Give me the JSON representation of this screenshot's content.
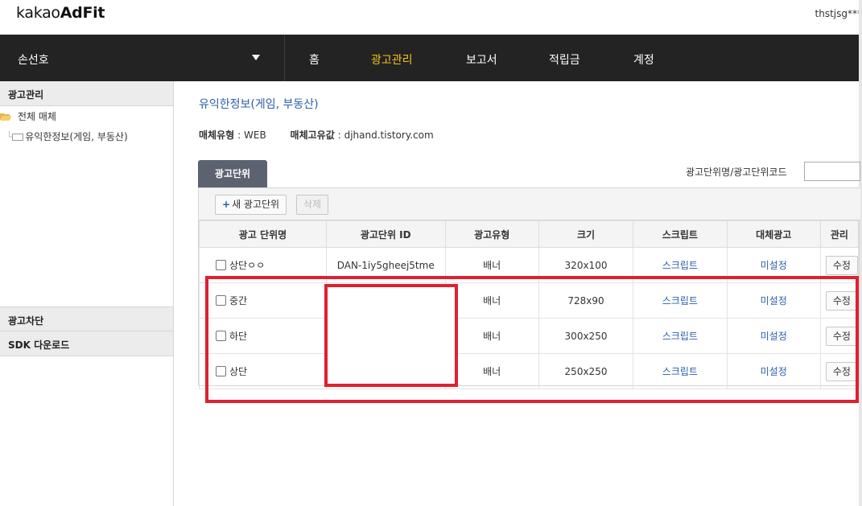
{
  "header": {
    "logo_regular": "kakao",
    "logo_bold": "AdFit",
    "user": "thstjsg***"
  },
  "gnb": {
    "media_name": "손선호",
    "items": [
      "홈",
      "광고관리",
      "보고서",
      "적립금",
      "계정"
    ],
    "active": "광고관리"
  },
  "sidebar": {
    "section_ad_manage": "광고관리",
    "tree_all": "전체 매체",
    "tree_media": "유익한정보(게임, 부동산)",
    "section_block": "광고차단",
    "section_sdk": "SDK 다운로드"
  },
  "main": {
    "title": "유익한정보(게임, 부동산)",
    "media_type_label": "매체유형",
    "media_type_value": ": WEB",
    "media_id_label": "매체고유값",
    "media_id_value": ": djhand.tistory.com",
    "tab_label": "광고단위",
    "search_label": "광고단위명/광고단위코드",
    "search_value": "",
    "new_button": "새 광고단위",
    "delete_button": "삭제"
  },
  "table": {
    "headers": [
      "광고 단위명",
      "광고단위 ID",
      "광고유형",
      "크기",
      "스크립트",
      "대체광고",
      "관리"
    ],
    "rows": [
      {
        "name": "상단ㅇㅇ",
        "id": "DAN-1iy5gheej5tme",
        "type": "배너",
        "size": "320x100",
        "script": "스크립트",
        "fallback": "미설정",
        "manage": "수정"
      },
      {
        "name": "중간",
        "id": "",
        "type": "배너",
        "size": "728x90",
        "script": "스크립트",
        "fallback": "미설정",
        "manage": "수정"
      },
      {
        "name": "하단",
        "id": "",
        "type": "배너",
        "size": "300x250",
        "script": "스크립트",
        "fallback": "미설정",
        "manage": "수정"
      },
      {
        "name": "상단",
        "id": "",
        "type": "배너",
        "size": "250x250",
        "script": "스크립트",
        "fallback": "미설정",
        "manage": "수정"
      }
    ]
  },
  "colors": {
    "nav_bg": "#232323",
    "nav_active": "#f5c517",
    "link": "#2b5ea8",
    "highlight_box": "#e02030"
  }
}
